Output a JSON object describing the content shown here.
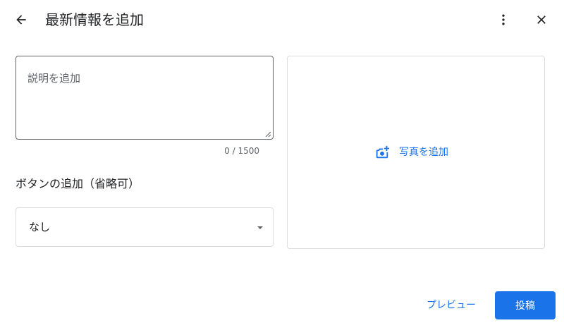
{
  "header": {
    "title": "最新情報を追加",
    "back_icon": "arrow-left-icon",
    "more_icon": "more-vertical-icon",
    "close_icon": "close-icon"
  },
  "description": {
    "placeholder": "説明を追加",
    "value": "",
    "counter": "0 / 1500"
  },
  "buttons_section": {
    "heading": "ボタンの追加（省略可）",
    "selected": "なし"
  },
  "photo": {
    "add_label": "写真を追加",
    "icon": "add-photo-icon"
  },
  "footer": {
    "preview_label": "プレビュー",
    "post_label": "投稿"
  },
  "colors": {
    "accent": "#1a73e8",
    "text_primary": "#202124",
    "text_secondary": "#5f6368",
    "border": "#dadce0"
  }
}
